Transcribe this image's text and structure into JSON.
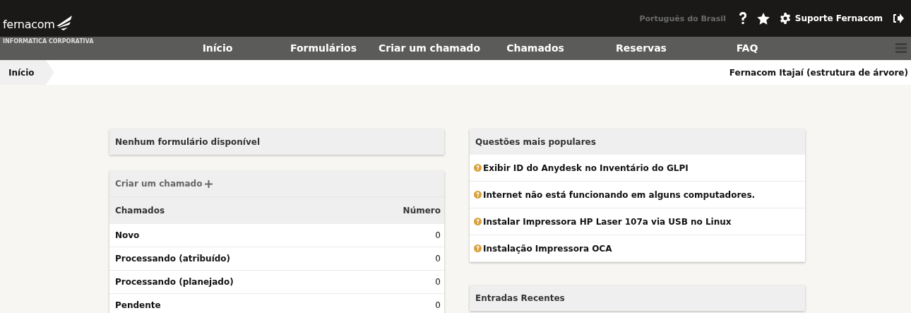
{
  "header": {
    "logo": {
      "name": "fernacom",
      "tagline": "INFORMATICA CORPORATIVA"
    },
    "language": "Português do Brasil",
    "user": "Suporte Fernacom"
  },
  "nav": [
    "Início",
    "Formulários",
    "Criar um chamado",
    "Chamados",
    "Reservas",
    "FAQ"
  ],
  "breadcrumb": {
    "current": "Início",
    "entity": "Fernacom Itajaí (estrutura de árvore)"
  },
  "forms_panel": {
    "message": "Nenhum formulário disponível"
  },
  "tickets_panel": {
    "create_link": "Criar um chamado",
    "columns": [
      "Chamados",
      "Número"
    ],
    "rows": [
      {
        "status": "Novo",
        "count": "0"
      },
      {
        "status": "Processando (atribuído)",
        "count": "0"
      },
      {
        "status": "Processando (planejado)",
        "count": "0"
      },
      {
        "status": "Pendente",
        "count": "0"
      }
    ]
  },
  "popular_panel": {
    "title": "Questões mais populares",
    "items": [
      "Exibir ID do Anydesk no Inventário do GLPI",
      "Internet não está funcionando em alguns computadores.",
      "Instalar Impressora HP Laser 107a via USB no Linux",
      "Instalação Impressora OCA"
    ]
  },
  "recent_panel": {
    "title": "Entradas Recentes"
  }
}
